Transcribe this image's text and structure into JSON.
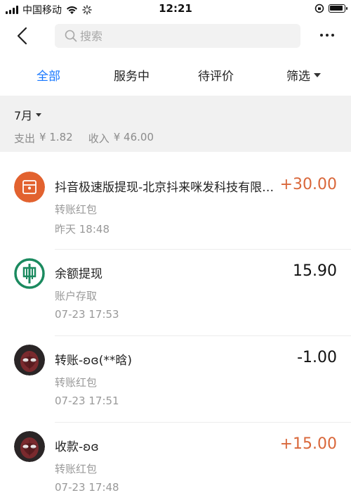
{
  "status_bar": {
    "carrier": "中国移动",
    "time": "12:21"
  },
  "nav": {
    "search_placeholder": "搜索"
  },
  "tabs": [
    {
      "label": "全部",
      "active": true
    },
    {
      "label": "服务中",
      "active": false
    },
    {
      "label": "待评价",
      "active": false
    },
    {
      "label": "筛选",
      "active": false
    }
  ],
  "summary": {
    "month": "7月",
    "expense_label": "支出",
    "expense_value": "¥ 1.82",
    "income_label": "收入",
    "income_value": "¥ 46.00"
  },
  "transactions": [
    {
      "title": "抖音极速版提现-北京抖来咪发科技有限公司",
      "amount": "+30.00",
      "category": "转账红包",
      "time": "昨天  18:48",
      "icon": "red-envelope-icon"
    },
    {
      "title": "余额提现",
      "amount": "15.90",
      "category": "账户存取",
      "time": "07-23  17:53",
      "icon": "bank-logo-icon"
    },
    {
      "title": "转账-ʚɞ(**晗)",
      "amount": "-1.00",
      "category": "转账红包",
      "time": "07-23  17:51",
      "icon": "user-avatar"
    },
    {
      "title": "收款-ʚɞ",
      "amount": "+15.00",
      "category": "转账红包",
      "time": "07-23  17:48",
      "icon": "user-avatar"
    }
  ],
  "colors": {
    "accent": "#1677ff",
    "income": "#d9673a",
    "red_envelope_bg": "#e2622f",
    "bank_green": "#1b8a5f"
  }
}
